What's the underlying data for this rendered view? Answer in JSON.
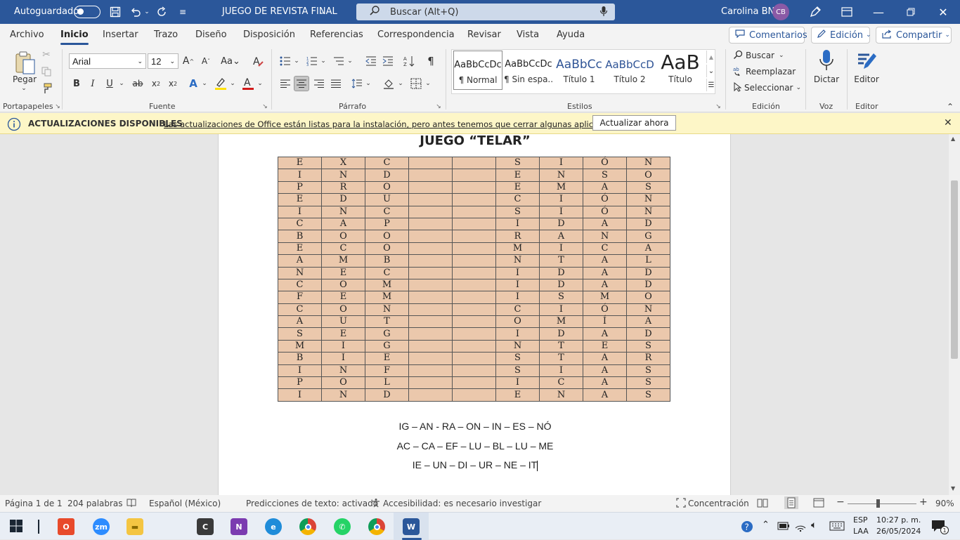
{
  "titlebar": {
    "autosave_label": "Autoguardado",
    "doc_title": "JUEGO DE REVISTA FINAL",
    "search_placeholder": "Buscar (Alt+Q)",
    "user_name": "Carolina BN",
    "user_initials": "CB"
  },
  "menu": {
    "tabs": [
      "Archivo",
      "Inicio",
      "Insertar",
      "Trazo",
      "Diseño",
      "Disposición",
      "Referencias",
      "Correspondencia",
      "Revisar",
      "Vista",
      "Ayuda"
    ],
    "comments_label": "Comentarios",
    "edit_label": "Edición",
    "share_label": "Compartir"
  },
  "ribbon": {
    "clipboard": {
      "paste_label": "Pegar",
      "group_label": "Portapapeles"
    },
    "font": {
      "name": "Arial",
      "size": "12",
      "group_label": "Fuente"
    },
    "paragraph": {
      "group_label": "Párrafo"
    },
    "styles": {
      "group_label": "Estilos",
      "items": [
        {
          "preview": "AaBbCcDc",
          "name": "¶ Normal"
        },
        {
          "preview": "AaBbCcDc",
          "name": "¶ Sin espa..."
        },
        {
          "preview": "AaBbCc",
          "name": "Título 1"
        },
        {
          "preview": "AaBbCcD",
          "name": "Título 2"
        },
        {
          "preview": "AaB",
          "name": "Título"
        }
      ]
    },
    "editing": {
      "find": "Buscar",
      "replace": "Reemplazar",
      "select": "Seleccionar",
      "group_label": "Edición"
    },
    "voice": {
      "dictate": "Dictar",
      "group_label": "Voz"
    },
    "editor": {
      "label": "Editor",
      "group_label": "Editor"
    }
  },
  "notification": {
    "title": "ACTUALIZACIONES DISPONIBLES",
    "message": "Las actualizaciones de Office están listas para la instalación, pero antes tenemos que cerrar algunas aplicaciones.",
    "button": "Actualizar ahora"
  },
  "document": {
    "heading": "JUEGO “TELAR”",
    "table_rows": [
      [
        "E",
        "X",
        "C",
        "",
        "",
        "S",
        "I",
        "Ó",
        "N"
      ],
      [
        "I",
        "N",
        "D",
        "",
        "",
        "E",
        "N",
        "S",
        "O"
      ],
      [
        "P",
        "R",
        "O",
        "",
        "",
        "E",
        "M",
        "A",
        "S"
      ],
      [
        "E",
        "D",
        "U",
        "",
        "",
        "C",
        "I",
        "Ó",
        "N"
      ],
      [
        "I",
        "N",
        "C",
        "",
        "",
        "S",
        "I",
        "Ó",
        "N"
      ],
      [
        "C",
        "A",
        "P",
        "",
        "",
        "I",
        "D",
        "A",
        "D"
      ],
      [
        "B",
        "O",
        "O",
        "",
        "",
        "R",
        "A",
        "N",
        "G"
      ],
      [
        "E",
        "C",
        "O",
        "",
        "",
        "M",
        "I",
        "C",
        "A"
      ],
      [
        "A",
        "M",
        "B",
        "",
        "",
        "N",
        "T",
        "A",
        "L"
      ],
      [
        "N",
        "E",
        "C",
        "",
        "",
        "I",
        "D",
        "A",
        "D"
      ],
      [
        "C",
        "O",
        "M",
        "",
        "",
        "I",
        "D",
        "A",
        "D"
      ],
      [
        "F",
        "E",
        "M",
        "",
        "",
        "I",
        "S",
        "M",
        "O"
      ],
      [
        "C",
        "O",
        "N",
        "",
        "",
        "C",
        "I",
        "Ó",
        "N"
      ],
      [
        "A",
        "U",
        "T",
        "",
        "",
        "O",
        "M",
        "Í",
        "A"
      ],
      [
        "S",
        "E",
        "G",
        "",
        "",
        "I",
        "D",
        "A",
        "D"
      ],
      [
        "M",
        "I",
        "G",
        "",
        "",
        "N",
        "T",
        "E",
        "S"
      ],
      [
        "B",
        "I",
        "E",
        "",
        "",
        "S",
        "T",
        "A",
        "R"
      ],
      [
        "I",
        "N",
        "F",
        "",
        "",
        "S",
        "I",
        "A",
        "S"
      ],
      [
        "P",
        "O",
        "L",
        "",
        "",
        "I",
        "C",
        "A",
        "S"
      ],
      [
        "I",
        "N",
        "D",
        "",
        "",
        "E",
        "N",
        "A",
        "S"
      ]
    ],
    "syllables": [
      "IG – AN - RA – ON – IN – ES – NÓ",
      "AC – CA – EF – LU – BL – LU – ME",
      "IE – UN – DI – UR – NE – IT"
    ]
  },
  "statusbar": {
    "page": "Página 1 de 1",
    "words": "204 palabras",
    "language": "Español (México)",
    "predictions": "Predicciones de texto: activado",
    "accessibility": "Accesibilidad: es necesario investigar",
    "focus": "Concentración",
    "zoom": "90%"
  },
  "taskbar": {
    "lang_top": "ESP",
    "lang_bottom": "LAA",
    "time": "10:27 p. m.",
    "date": "26/05/2024",
    "notif_count": "1"
  }
}
